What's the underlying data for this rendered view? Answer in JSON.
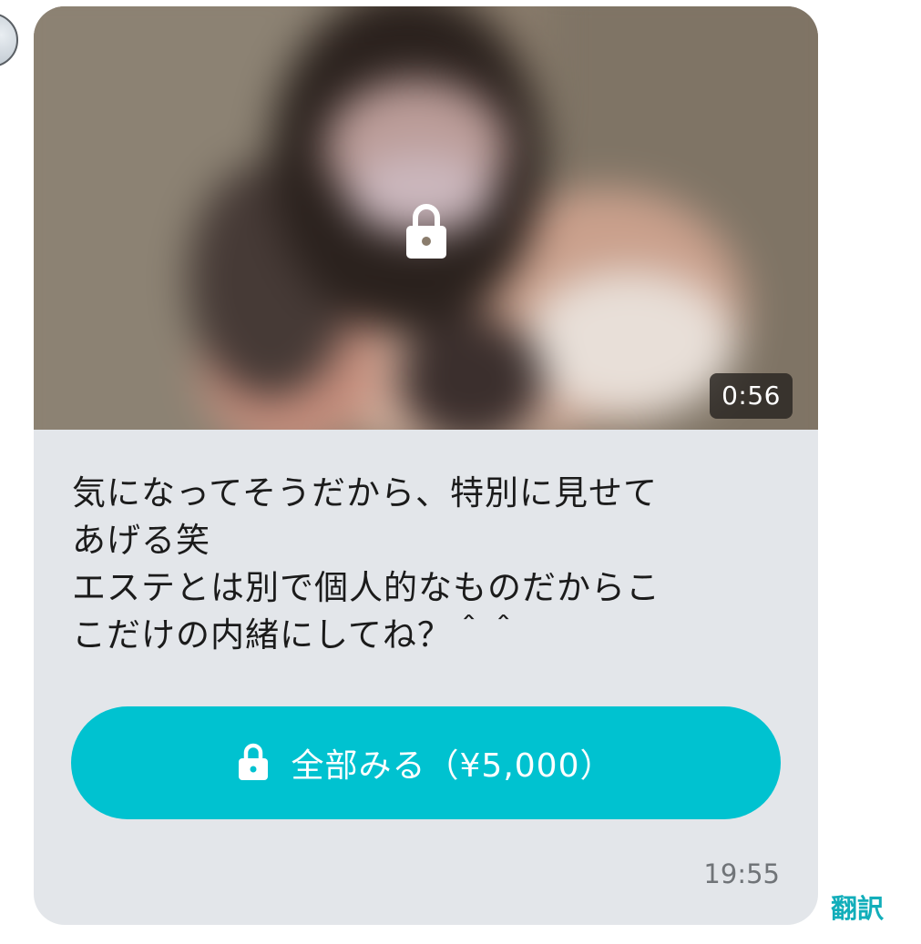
{
  "message": {
    "media": {
      "locked": true,
      "duration": "0:56",
      "lock_icon": "lock-icon"
    },
    "text": "気になってそうだから、特別に見せて\nあげる笑\nエステとは別で個人的なものだからこ\nこだけの内緒にしてね？＾＾",
    "unlock_button": {
      "label": "全部みる（¥5,000）",
      "icon": "lock-icon",
      "color": "#00c2d0"
    },
    "timestamp": "19:55"
  },
  "translate_label": "翻訳",
  "colors": {
    "bubble": "#e3e6ea",
    "accent": "#00c2d0",
    "translate": "#12aeba"
  }
}
